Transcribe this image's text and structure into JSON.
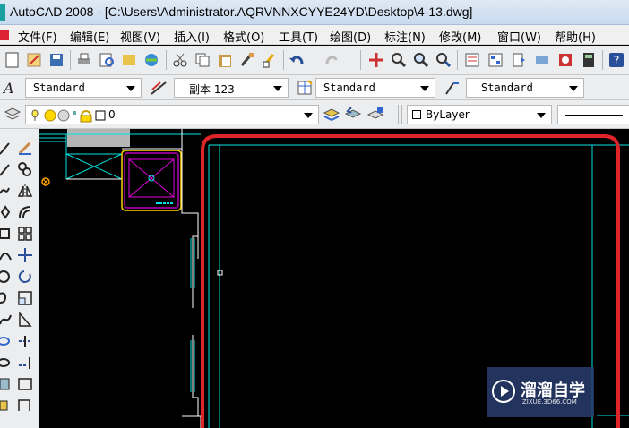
{
  "window": {
    "title": "AutoCAD 2008 - [C:\\Users\\Administrator.AQRVNNXCYYE24YD\\Desktop\\4-13.dwg]"
  },
  "menu": [
    "文件(F)",
    "编辑(E)",
    "视图(V)",
    "插入(I)",
    "格式(O)",
    "工具(T)",
    "绘图(D)",
    "标注(N)",
    "修改(M)",
    "窗口(W)",
    "帮助(H)"
  ],
  "styles_toolbar": {
    "text_style": "Standard",
    "dim_style": "副本 123",
    "table_style": "Standard",
    "multileader_style": "Standard"
  },
  "layers_toolbar": {
    "current_layer": "0",
    "color_control": "ByLayer"
  },
  "watermark": {
    "brand": "溜溜自学",
    "url": "ZIXUE.3D66.COM"
  },
  "colors": {
    "highlight": "#e0242a",
    "cyan": "#00e5e5",
    "magenta": "#e000e0",
    "yellow": "#ffd000"
  }
}
